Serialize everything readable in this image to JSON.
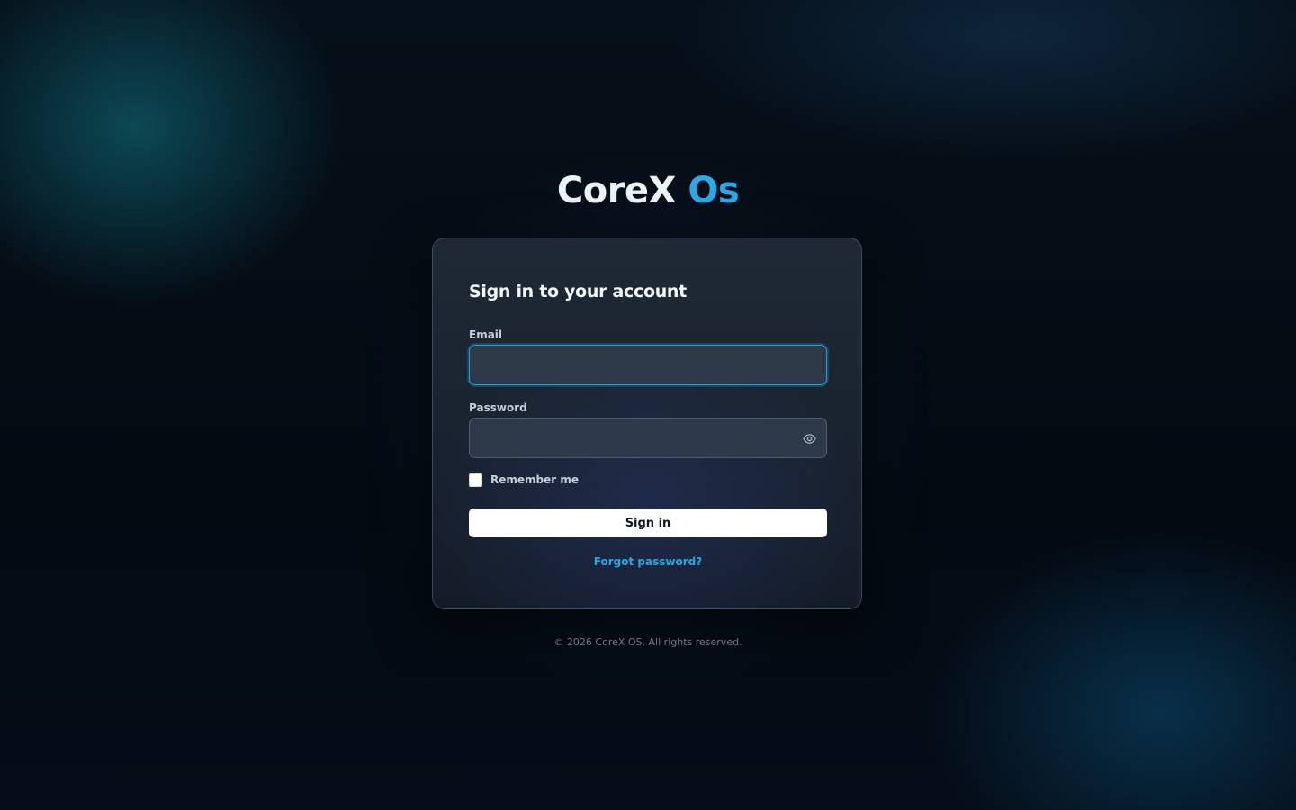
{
  "brand": {
    "name_main": "CoreX",
    "name_accent": "Os",
    "accent_color": "#2aa8e8"
  },
  "login": {
    "title": "Sign in to your account",
    "email": {
      "label": "Email",
      "value": "",
      "focused": true
    },
    "password": {
      "label": "Password",
      "value": "",
      "toggle_icon": "eye-icon"
    },
    "remember_me": {
      "label": "Remember me",
      "checked": false
    },
    "submit_label": "Sign in",
    "forgot_label": "Forgot password?"
  },
  "footer": {
    "text": "© 2026 CoreX OS. All rights reserved."
  }
}
